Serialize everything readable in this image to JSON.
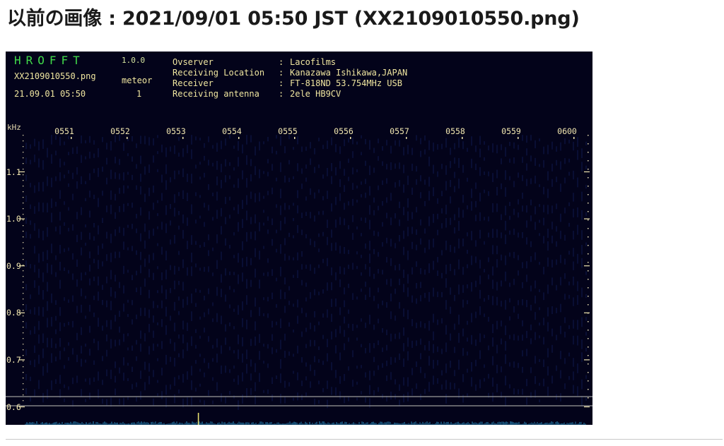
{
  "page": {
    "title": "以前の画像 : 2021/09/01 05:50 JST (XX2109010550.png)"
  },
  "header": {
    "brand": "HROFFT",
    "version": "1.0.0",
    "filename": "XX2109010550.png",
    "timestamp": "21.09.01 05:50",
    "meteor_label": "meteor",
    "meteor_count": "1"
  },
  "info": [
    {
      "key": "Ovserver",
      "sep": ":",
      "value": "Lacofilms"
    },
    {
      "key": "Receiving Location",
      "sep": ":",
      "value": "Kanazawa Ishikawa,JAPAN"
    },
    {
      "key": "Receiver",
      "sep": ":",
      "value": "FT-818ND 53.754MHz USB"
    },
    {
      "key": "Receiving antenna",
      "sep": ":",
      "value": "2ele HB9CV"
    }
  ],
  "colors": {
    "background": "#03031a",
    "brand": "#41d94a",
    "text": "#f0e6a0",
    "noise": "#2fa8e0",
    "meteor": "#e8e070"
  },
  "chart_data": {
    "type": "heatmap",
    "x_ticks": [
      "0551",
      "0552",
      "0553",
      "0554",
      "0555",
      "0556",
      "0557",
      "0558",
      "0559",
      "0600"
    ],
    "y_unit": "kHz",
    "y_ticks": [
      "1.1",
      "1.0",
      "0.9",
      "0.8",
      "0.7",
      "0.6"
    ],
    "y_values": [
      1.1,
      1.0,
      0.9,
      0.8,
      0.7,
      0.6
    ],
    "meteors": [
      {
        "time": "05:53.4",
        "freq_khz": 0.553
      }
    ]
  }
}
